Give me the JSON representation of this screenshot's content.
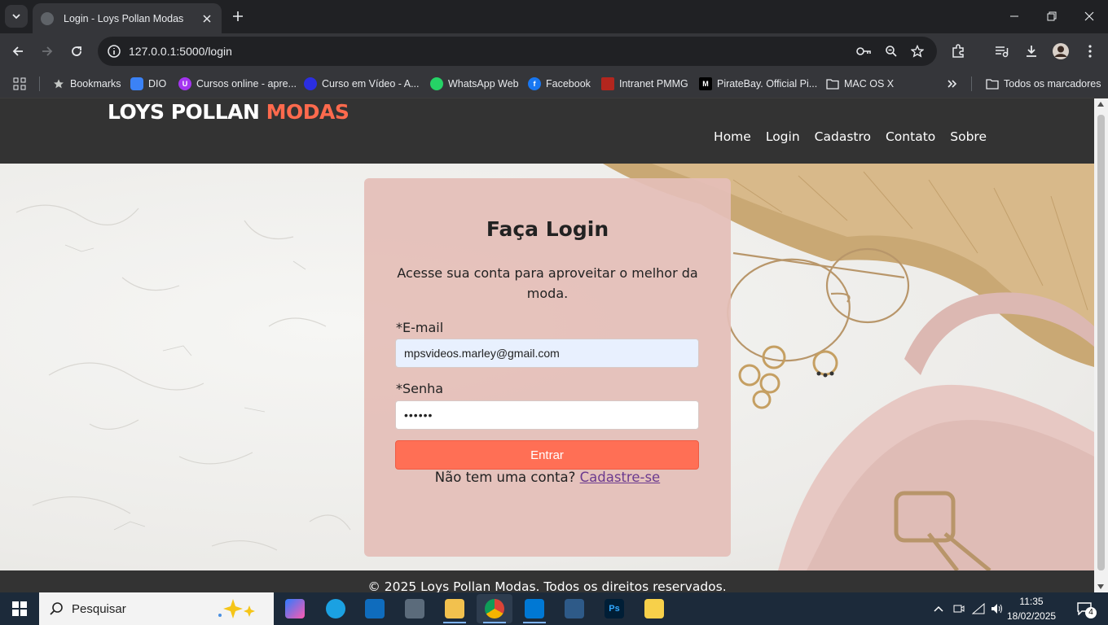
{
  "browser": {
    "tab_title": "Login - Loys Pollan Modas",
    "url_host": "127.0.0.1",
    "url_path": ":5000/login",
    "bookmarks": [
      {
        "label": "Bookmarks",
        "icon": "star-icon"
      },
      {
        "label": "DIO",
        "icon": "dio-icon"
      },
      {
        "label": "Cursos online - apre...",
        "icon": "udemy-icon"
      },
      {
        "label": "Curso em Vídeo - A...",
        "icon": "cursoemvideo-icon"
      },
      {
        "label": "WhatsApp Web",
        "icon": "whatsapp-icon"
      },
      {
        "label": "Facebook",
        "icon": "facebook-icon"
      },
      {
        "label": "Intranet PMMG",
        "icon": "pmmg-icon"
      },
      {
        "label": "PirateBay. Official Pi...",
        "icon": "piratebay-icon"
      },
      {
        "label": "MAC OS X",
        "icon": "folder-icon"
      }
    ],
    "all_bookmarks_label": "Todos os marcadores"
  },
  "site": {
    "logo_main": "LOYS POLLAN",
    "logo_accent": "MODAS",
    "nav": [
      "Home",
      "Login",
      "Cadastro",
      "Contato",
      "Sobre"
    ],
    "footer": "© 2025 Loys Pollan Modas. Todos os direitos reservados."
  },
  "login": {
    "title": "Faça Login",
    "subtitle": "Acesse sua conta para aproveitar o melhor da moda.",
    "email_label": "*E-mail",
    "email_value": "mpsvideos.marley@gmail.com",
    "password_label": "*Senha",
    "password_value": "••••••",
    "submit_label": "Entrar",
    "signup_prompt": "Não tem uma conta?",
    "signup_link": "Cadastre-se"
  },
  "taskbar": {
    "search_placeholder": "Pesquisar",
    "time": "11:35",
    "date": "18/02/2025",
    "notification_count": "4"
  },
  "colors": {
    "accent": "#ff6a4d",
    "card": "#e4beb8",
    "header": "#333333"
  }
}
